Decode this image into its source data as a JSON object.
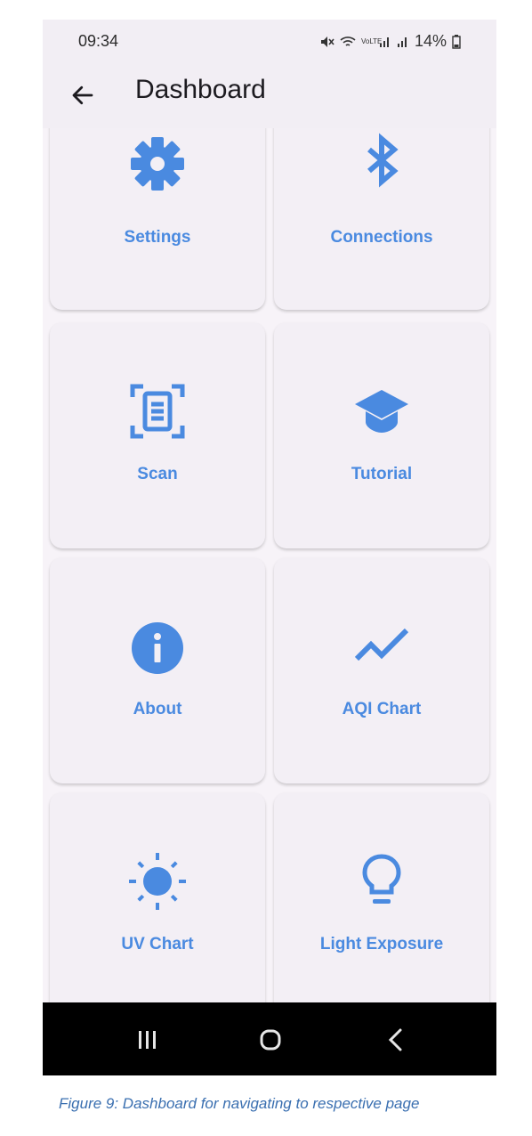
{
  "status_bar": {
    "time": "09:34",
    "battery": "14%",
    "icons": [
      "mute-icon",
      "wifi-icon",
      "volte-icon",
      "signal-icon",
      "signal-icon",
      "battery-icon"
    ],
    "volte_text": "VoLTE"
  },
  "app_bar": {
    "title": "Dashboard",
    "back_icon": "arrow-back-icon"
  },
  "dashboard": {
    "accent_color": "#4a8ae0",
    "items": [
      {
        "label": "Settings",
        "icon": "gear-icon"
      },
      {
        "label": "Connections",
        "icon": "bluetooth-icon"
      },
      {
        "label": "Scan",
        "icon": "document-scanner-icon"
      },
      {
        "label": "Tutorial",
        "icon": "graduation-cap-icon"
      },
      {
        "label": "About",
        "icon": "info-icon"
      },
      {
        "label": "AQI Chart",
        "icon": "trending-line-icon"
      },
      {
        "label": "UV Chart",
        "icon": "sun-icon"
      },
      {
        "label": "Light Exposure",
        "icon": "lightbulb-icon"
      }
    ]
  },
  "nav_bar": {
    "recents_icon": "recents-icon",
    "home_icon": "home-icon",
    "back_icon": "nav-back-icon"
  },
  "caption": "Figure 9: Dashboard for navigating to respective page"
}
